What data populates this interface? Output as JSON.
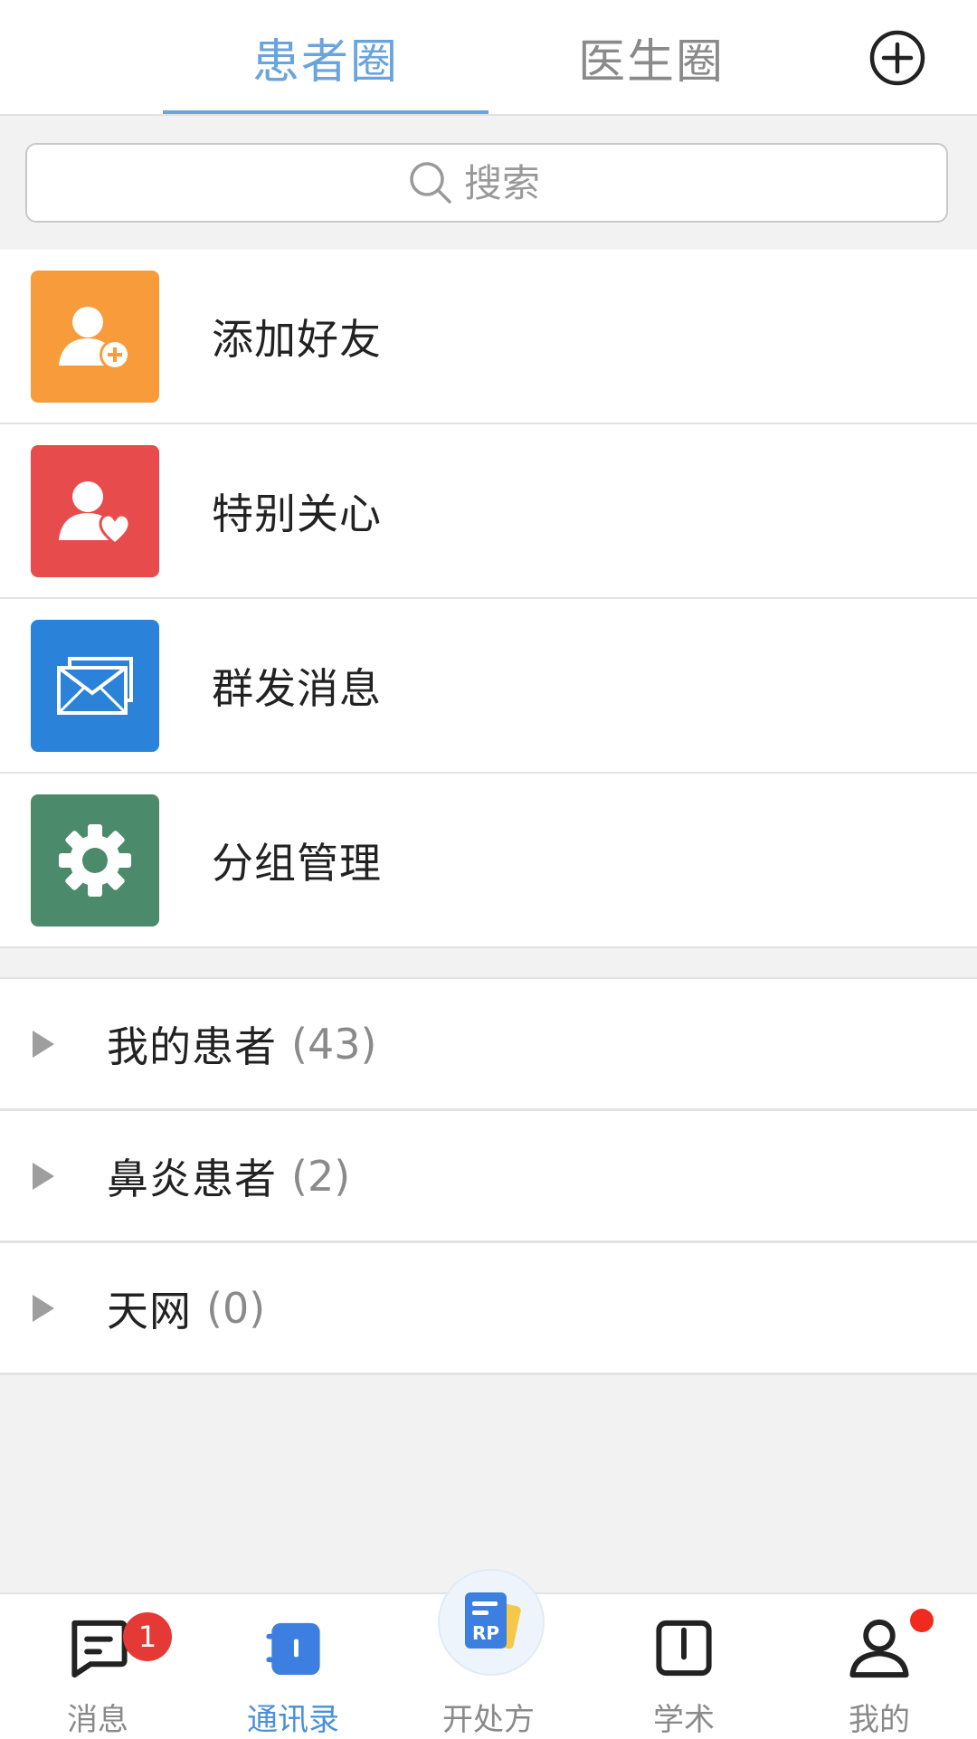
{
  "header": {
    "tabs": [
      {
        "label": "患者圈",
        "active": true
      },
      {
        "label": "医生圈",
        "active": false
      }
    ],
    "add_icon": "plus-circle-icon"
  },
  "search": {
    "placeholder": "搜索",
    "icon": "search-icon"
  },
  "menu": [
    {
      "label": "添加好友",
      "icon": "add-friend-icon",
      "color": "#f89c3b"
    },
    {
      "label": "特别关心",
      "icon": "special-care-icon",
      "color": "#e84b4b"
    },
    {
      "label": "群发消息",
      "icon": "mass-message-icon",
      "color": "#2b82d9"
    },
    {
      "label": "分组管理",
      "icon": "gear-icon",
      "color": "#4c8a6c"
    }
  ],
  "groups": [
    {
      "name": "我的患者",
      "count": "(43)"
    },
    {
      "name": "鼻炎患者",
      "count": "(2)"
    },
    {
      "name": "天网",
      "count": "(0)"
    }
  ],
  "tabbar": [
    {
      "label": "消息",
      "icon": "message-icon",
      "badge": "1"
    },
    {
      "label": "通讯录",
      "icon": "contacts-icon",
      "active": true
    },
    {
      "label": "开处方",
      "icon": "prescription-icon",
      "icon_text": "RP"
    },
    {
      "label": "学术",
      "icon": "academic-book-icon"
    },
    {
      "label": "我的",
      "icon": "profile-icon",
      "dot": true
    }
  ],
  "colors": {
    "accent": "#6aa4dc",
    "active_nav": "#4a90d9",
    "badge": "#e53935"
  }
}
